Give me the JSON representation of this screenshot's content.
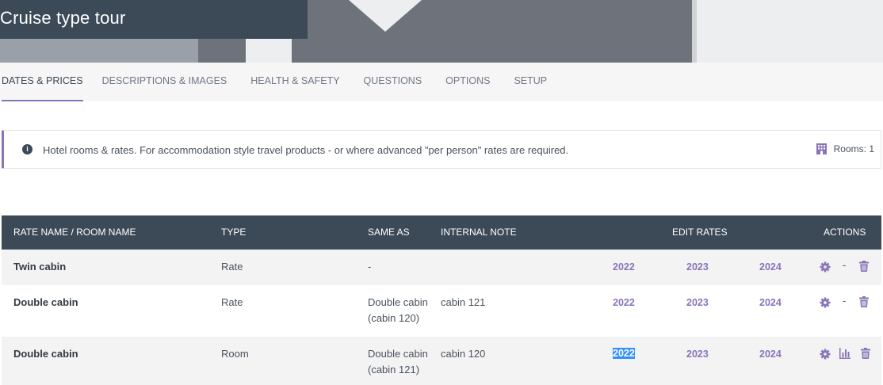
{
  "header": {
    "title": "Cruise type tour"
  },
  "tabs": [
    {
      "label": "DATES & PRICES",
      "active": true
    },
    {
      "label": "DESCRIPTIONS & IMAGES"
    },
    {
      "label": "HEALTH & SAFETY"
    },
    {
      "label": "QUESTIONS"
    },
    {
      "label": "OPTIONS"
    },
    {
      "label": "SETUP"
    }
  ],
  "info": {
    "icon": "info-icon",
    "message": "Hotel rooms & rates. For accommodation style travel products - or where advanced \"per person\" rates are required.",
    "rooms_label": "Rooms: 1"
  },
  "table": {
    "headers": {
      "name": "RATE NAME / ROOM NAME",
      "type": "TYPE",
      "same_as": "SAME AS",
      "note": "INTERNAL NOTE",
      "edit_rates": "EDIT RATES",
      "actions": "ACTIONS"
    },
    "rows": [
      {
        "name": "Twin cabin",
        "type": "Rate",
        "same_as": "-",
        "same_as_2": "",
        "note": "",
        "years": [
          "2022",
          "2023",
          "2024"
        ],
        "middle": "-"
      },
      {
        "name": "Double cabin",
        "type": "Rate",
        "same_as": "Double cabin",
        "same_as_2": "(cabin 120)",
        "note": "cabin 121",
        "years": [
          "2022",
          "2023",
          "2024"
        ],
        "middle": "-"
      },
      {
        "name": "Double cabin",
        "type": "Room",
        "same_as": "Double cabin",
        "same_as_2": "(cabin 121)",
        "note": "cabin 120",
        "years": [
          "2022",
          "2023",
          "2024"
        ],
        "middle": ""
      }
    ]
  },
  "colors": {
    "accent": "#8a74b8",
    "header_bg": "#3c4a58",
    "selection": "#3390ff"
  }
}
